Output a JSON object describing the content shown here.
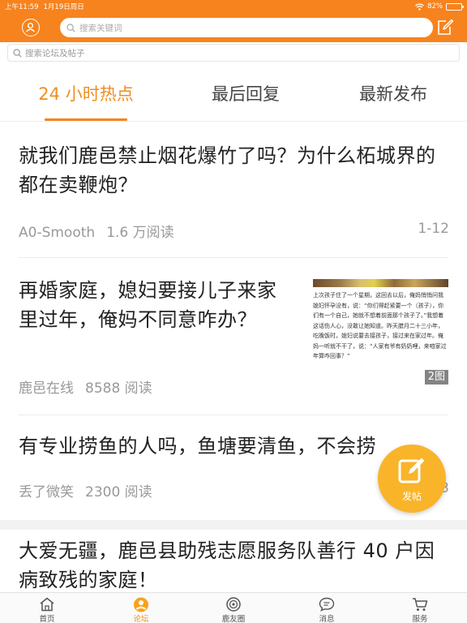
{
  "status_bar": {
    "time": "上午11:59",
    "date": "1月19日周日",
    "battery": "82%",
    "battery_level": 0.82
  },
  "header": {
    "search_placeholder": "搜索关键词",
    "avatar_icon": "user-icon",
    "compose_icon": "compose-icon"
  },
  "sub_search": {
    "placeholder": "搜索论坛及帖子"
  },
  "tabs": [
    {
      "label": "24 小时热点",
      "active": true
    },
    {
      "label": "最后回复",
      "active": false
    },
    {
      "label": "最新发布",
      "active": false
    }
  ],
  "posts": [
    {
      "title": "就我们鹿邑禁止烟花爆竹了吗？为什么柘城界的都在卖鞭炮？",
      "author": "A0-Smooth",
      "reads": "1.6 万阅读",
      "pages": "1-12"
    },
    {
      "title": "再婚家庭，媳妇要接儿子来家里过年，俺妈不同意咋办？",
      "author": "鹿邑在线",
      "reads": "8588 阅读",
      "thumb_text": "上次孩子住了一个星期，这回去以后，俺妈悄悄问我媳妇怀孕没有，说：“你们得赶紧要一个（孩子），你们有一个自己，她就不想着前面那个孩子了。”我想着这话伤人心，没敢让她知道。昨天腊月二十三小年，吃晚饭时，媳妇说要去接孩子，接过来在家过年。俺妈一听就不干了，说：“人家有爷有奶奶哩，来咱家过年算咋回事？”",
      "thumb_count": "2图"
    },
    {
      "title": "有专业捞鱼的人吗，鱼塘要清鱼，不会捞",
      "author": "丢了微笑",
      "reads": "2300 阅读",
      "pages": "1-3"
    },
    {
      "title": "大爱无疆，鹿邑县助残志愿服务队善行 40 户因病致残的家庭！"
    }
  ],
  "fab": {
    "label": "发帖",
    "icon": "edit-icon"
  },
  "bottom_nav": [
    {
      "label": "首页",
      "icon": "home-icon",
      "active": false
    },
    {
      "label": "论坛",
      "icon": "forum-icon",
      "active": true
    },
    {
      "label": "鹿友圈",
      "icon": "circle-icon",
      "active": false
    },
    {
      "label": "消息",
      "icon": "message-icon",
      "active": false
    },
    {
      "label": "服务",
      "icon": "cart-icon",
      "active": false
    }
  ],
  "colors": {
    "brand": "#f7831e",
    "active_text": "#f08d1f",
    "fab": "#f9b42a"
  }
}
